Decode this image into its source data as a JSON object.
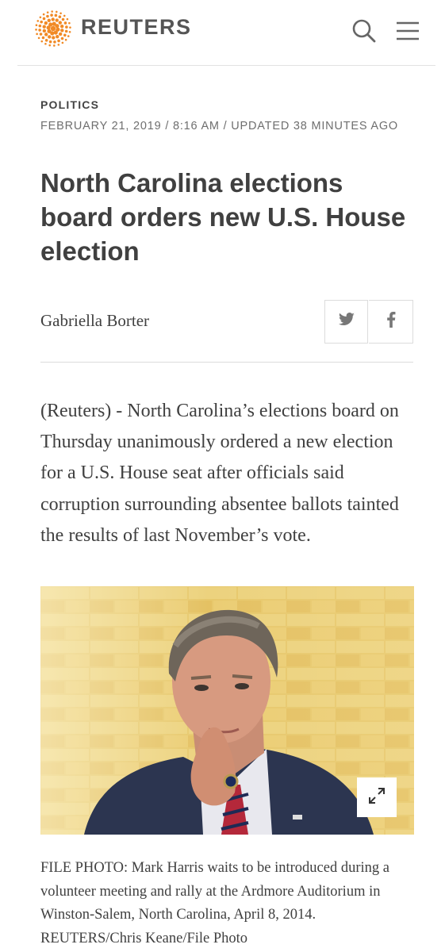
{
  "header": {
    "brand": "REUTERS",
    "logo_icon": "reuters-dot-logo",
    "search_icon": "search-icon",
    "menu_icon": "hamburger-menu-icon",
    "accent_color": "#f18a26"
  },
  "article": {
    "section": "POLITICS",
    "dateline": "FEBRUARY 21, 2019 / 8:16 AM / UPDATED 38 MINUTES AGO",
    "headline": "North Carolina elections board orders new U.S. House election",
    "byline": "Gabriella Borter",
    "share": {
      "twitter_icon": "twitter-icon",
      "facebook_icon": "facebook-icon"
    },
    "lede": "(Reuters) - North Carolina’s elections board on Thursday unanimously ordered a new election for a U.S. House seat after officials said corruption surrounding absentee ballots tainted the results of last November’s vote.",
    "photo": {
      "expand_icon": "expand-icon",
      "caption": "FILE PHOTO: Mark Harris waits to be introduced during a volunteer meeting and rally at the Ardmore Auditorium in Winston-Salem, North Carolina, April 8, 2014. REUTERS/Chris Keane/File Photo"
    }
  }
}
